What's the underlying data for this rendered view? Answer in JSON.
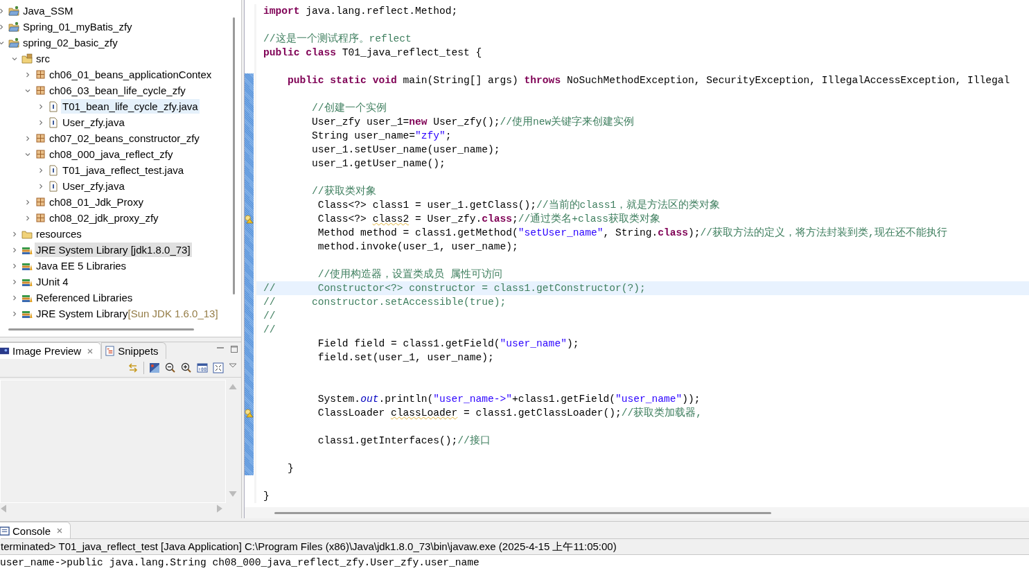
{
  "explorer": {
    "tree": [
      {
        "label": "Java_SSM",
        "kind": "project",
        "expanded": false,
        "selected": false,
        "hovered": false
      },
      {
        "label": "Spring_01_myBatis_zfy",
        "kind": "project",
        "expanded": false,
        "selected": false,
        "hovered": false
      },
      {
        "label": "spring_02_basic_zfy",
        "kind": "project",
        "expanded": true,
        "selected": false,
        "hovered": false,
        "children": [
          {
            "label": "src",
            "kind": "source-folder",
            "expanded": true,
            "selected": false,
            "hovered": false,
            "children": [
              {
                "label": "ch06_01_beans_applicationContex",
                "kind": "package",
                "expanded": false,
                "selected": false,
                "hovered": false
              },
              {
                "label": "ch06_03_bean_life_cycle_zfy",
                "kind": "package",
                "expanded": true,
                "selected": false,
                "hovered": false,
                "children": [
                  {
                    "label": "T01_bean_life_cycle_zfy.java",
                    "kind": "java-file",
                    "expanded": false,
                    "selected": true,
                    "hovered": false
                  },
                  {
                    "label": "User_zfy.java",
                    "kind": "java-file",
                    "expanded": false,
                    "selected": false,
                    "hovered": false
                  }
                ]
              },
              {
                "label": "ch07_02_beans_constructor_zfy",
                "kind": "package",
                "expanded": false,
                "selected": false,
                "hovered": false
              },
              {
                "label": "ch08_000_java_reflect_zfy",
                "kind": "package",
                "expanded": true,
                "selected": false,
                "hovered": false,
                "children": [
                  {
                    "label": "T01_java_reflect_test.java",
                    "kind": "java-file",
                    "expanded": false,
                    "selected": false,
                    "hovered": false
                  },
                  {
                    "label": "User_zfy.java",
                    "kind": "java-file",
                    "expanded": false,
                    "selected": false,
                    "hovered": false
                  }
                ]
              },
              {
                "label": "ch08_01_Jdk_Proxy",
                "kind": "package",
                "expanded": false,
                "selected": false,
                "hovered": false
              },
              {
                "label": "ch08_02_jdk_proxy_zfy",
                "kind": "package",
                "expanded": false,
                "selected": false,
                "hovered": false
              }
            ]
          },
          {
            "label": "resources",
            "kind": "folder",
            "expanded": false,
            "selected": false,
            "hovered": false
          },
          {
            "label": "JRE System Library [jdk1.8.0_73]",
            "kind": "library",
            "expanded": false,
            "selected": false,
            "hovered": true
          },
          {
            "label": "Java EE 5 Libraries",
            "kind": "library",
            "expanded": false,
            "selected": false,
            "hovered": false
          },
          {
            "label": "JUnit 4",
            "kind": "library",
            "expanded": false,
            "selected": false,
            "hovered": false
          },
          {
            "label": "Referenced Libraries",
            "kind": "library",
            "expanded": false,
            "selected": false,
            "hovered": false
          },
          {
            "label": "JRE System Library",
            "decoration": "[Sun JDK 1.6.0_13]",
            "kind": "library",
            "expanded": false,
            "selected": false,
            "hovered": false
          }
        ]
      }
    ]
  },
  "preview_panel": {
    "tabs": [
      {
        "label": "Image Preview",
        "selected": true
      },
      {
        "label": "Snippets",
        "selected": false
      }
    ]
  },
  "editor": {
    "lines": [
      {
        "current": false,
        "warning": false,
        "changed": false,
        "tokens": [
          {
            "kind": "keyword",
            "text": "import"
          },
          {
            "kind": "plain",
            "text": " java.lang.reflect.Method;"
          }
        ]
      },
      {
        "current": false,
        "warning": false,
        "changed": false
      },
      {
        "current": false,
        "warning": false,
        "changed": false,
        "tokens": [
          {
            "kind": "comment",
            "text": "//这是一个测试程序。reflect"
          }
        ]
      },
      {
        "current": false,
        "warning": false,
        "changed": false,
        "tokens": [
          {
            "kind": "keyword",
            "text": "public class"
          },
          {
            "kind": "plain",
            "text": " T01_java_reflect_test {"
          }
        ]
      },
      {
        "current": false,
        "warning": false,
        "changed": false
      },
      {
        "current": false,
        "warning": false,
        "changed": true,
        "tokens": [
          {
            "kind": "keyword",
            "text": "    public static void"
          },
          {
            "kind": "plain",
            "text": " main(String[] args) "
          },
          {
            "kind": "keyword",
            "text": "throws"
          },
          {
            "kind": "plain",
            "text": " NoSuchMethodException, SecurityException, IllegalAccessException, Illegal"
          }
        ]
      },
      {
        "current": false,
        "warning": false,
        "changed": true
      },
      {
        "current": false,
        "warning": false,
        "changed": true,
        "tokens": [
          {
            "kind": "comment",
            "text": "        //创建一个实例"
          }
        ]
      },
      {
        "current": false,
        "warning": false,
        "changed": true,
        "tokens": [
          {
            "kind": "plain",
            "text": "        User_zfy user_1="
          },
          {
            "kind": "keyword",
            "text": "new"
          },
          {
            "kind": "plain",
            "text": " User_zfy();"
          },
          {
            "kind": "comment",
            "text": "//使用new关键字来创建实例"
          }
        ]
      },
      {
        "current": false,
        "warning": false,
        "changed": true,
        "tokens": [
          {
            "kind": "plain",
            "text": "        String user_name="
          },
          {
            "kind": "string",
            "text": "\"zfy\""
          },
          {
            "kind": "plain",
            "text": ";"
          }
        ]
      },
      {
        "current": false,
        "warning": false,
        "changed": true,
        "tokens": [
          {
            "kind": "plain",
            "text": "        user_1.setUser_name(user_name);"
          }
        ]
      },
      {
        "current": false,
        "warning": false,
        "changed": true,
        "tokens": [
          {
            "kind": "plain",
            "text": "        user_1.getUser_name();"
          }
        ]
      },
      {
        "current": false,
        "warning": false,
        "changed": true
      },
      {
        "current": false,
        "warning": false,
        "changed": true,
        "tokens": [
          {
            "kind": "comment",
            "text": "        //获取类对象"
          }
        ]
      },
      {
        "current": false,
        "warning": false,
        "changed": true,
        "tokens": [
          {
            "kind": "plain",
            "text": "         Class<?> class1 = user_1.getClass();"
          },
          {
            "kind": "comment",
            "text": "//当前的class1，就是方法区的类对象"
          }
        ]
      },
      {
        "current": false,
        "warning": true,
        "changed": true,
        "tokens": [
          {
            "kind": "plain",
            "text": "         Class<?> "
          },
          {
            "kind": "unused",
            "text": "class2"
          },
          {
            "kind": "plain",
            "text": " = User_zfy."
          },
          {
            "kind": "keyword",
            "text": "class"
          },
          {
            "kind": "plain",
            "text": ";"
          },
          {
            "kind": "comment",
            "text": "//通过类名+class获取类对象"
          }
        ]
      },
      {
        "current": false,
        "warning": false,
        "changed": true,
        "tokens": [
          {
            "kind": "plain",
            "text": "         Method method = class1.getMethod("
          },
          {
            "kind": "string",
            "text": "\"setUser_name\""
          },
          {
            "kind": "plain",
            "text": ", String."
          },
          {
            "kind": "keyword",
            "text": "class"
          },
          {
            "kind": "plain",
            "text": ");"
          },
          {
            "kind": "comment",
            "text": "//获取方法的定义，将方法封装到类,现在还不能执行"
          }
        ]
      },
      {
        "current": false,
        "warning": false,
        "changed": true,
        "tokens": [
          {
            "kind": "plain",
            "text": "         method.invoke(user_1, user_name);"
          }
        ]
      },
      {
        "current": false,
        "warning": false,
        "changed": true
      },
      {
        "current": false,
        "warning": false,
        "changed": true,
        "tokens": [
          {
            "kind": "comment",
            "text": "         //使用构造器，设置类成员 属性可访问"
          }
        ]
      },
      {
        "current": true,
        "warning": false,
        "changed": true,
        "tokens": [
          {
            "kind": "comment",
            "text": "//       Constructor<?> constructor = class1.getConstructor(?);"
          }
        ]
      },
      {
        "current": false,
        "warning": false,
        "changed": true,
        "tokens": [
          {
            "kind": "comment",
            "text": "//      constructor.setAccessible(true);"
          }
        ]
      },
      {
        "current": false,
        "warning": false,
        "changed": true,
        "tokens": [
          {
            "kind": "comment",
            "text": "//"
          }
        ]
      },
      {
        "current": false,
        "warning": false,
        "changed": true,
        "tokens": [
          {
            "kind": "comment",
            "text": "//"
          }
        ]
      },
      {
        "current": false,
        "warning": false,
        "changed": true,
        "tokens": [
          {
            "kind": "plain",
            "text": "         Field field = class1.getField("
          },
          {
            "kind": "string",
            "text": "\"user_name\""
          },
          {
            "kind": "plain",
            "text": ");"
          }
        ]
      },
      {
        "current": false,
        "warning": false,
        "changed": true,
        "tokens": [
          {
            "kind": "plain",
            "text": "         field.set(user_1, user_name);"
          }
        ]
      },
      {
        "current": false,
        "warning": false,
        "changed": true
      },
      {
        "current": false,
        "warning": false,
        "changed": true
      },
      {
        "current": false,
        "warning": false,
        "changed": true,
        "tokens": [
          {
            "kind": "plain",
            "text": "         System."
          },
          {
            "kind": "static-field",
            "text": "out"
          },
          {
            "kind": "plain",
            "text": ".println("
          },
          {
            "kind": "string",
            "text": "\"user_name->\""
          },
          {
            "kind": "plain",
            "text": "+class1.getField("
          },
          {
            "kind": "string",
            "text": "\"user_name\""
          },
          {
            "kind": "plain",
            "text": "));"
          }
        ]
      },
      {
        "current": false,
        "warning": true,
        "changed": true,
        "tokens": [
          {
            "kind": "plain",
            "text": "         ClassLoader "
          },
          {
            "kind": "unused",
            "text": "classLoader"
          },
          {
            "kind": "plain",
            "text": " = class1.getClassLoader();"
          },
          {
            "kind": "comment",
            "text": "//获取类加载器,"
          }
        ]
      },
      {
        "current": false,
        "warning": false,
        "changed": true
      },
      {
        "current": false,
        "warning": false,
        "changed": true,
        "tokens": [
          {
            "kind": "plain",
            "text": "         class1.getInterfaces();"
          },
          {
            "kind": "comment",
            "text": "//接口"
          }
        ]
      },
      {
        "current": false,
        "warning": false,
        "changed": true
      },
      {
        "current": false,
        "warning": false,
        "changed": true,
        "tokens": [
          {
            "kind": "plain",
            "text": "    }"
          }
        ]
      },
      {
        "current": false,
        "warning": false,
        "changed": false
      },
      {
        "current": false,
        "warning": false,
        "changed": false,
        "tokens": [
          {
            "kind": "plain",
            "text": "}"
          }
        ]
      }
    ]
  },
  "console": {
    "tabs": [
      {
        "label": "Console",
        "selected": true
      }
    ],
    "status": "terminated> T01_java_reflect_test [Java Application] C:\\Program Files (x86)\\Java\\jdk1.8.0_73\\bin\\javaw.exe (2025-4-15 上午11:05:00)",
    "output": [
      "user_name->public java.lang.String ch08_000_java_reflect_zfy.User_zfy.user_name"
    ]
  }
}
